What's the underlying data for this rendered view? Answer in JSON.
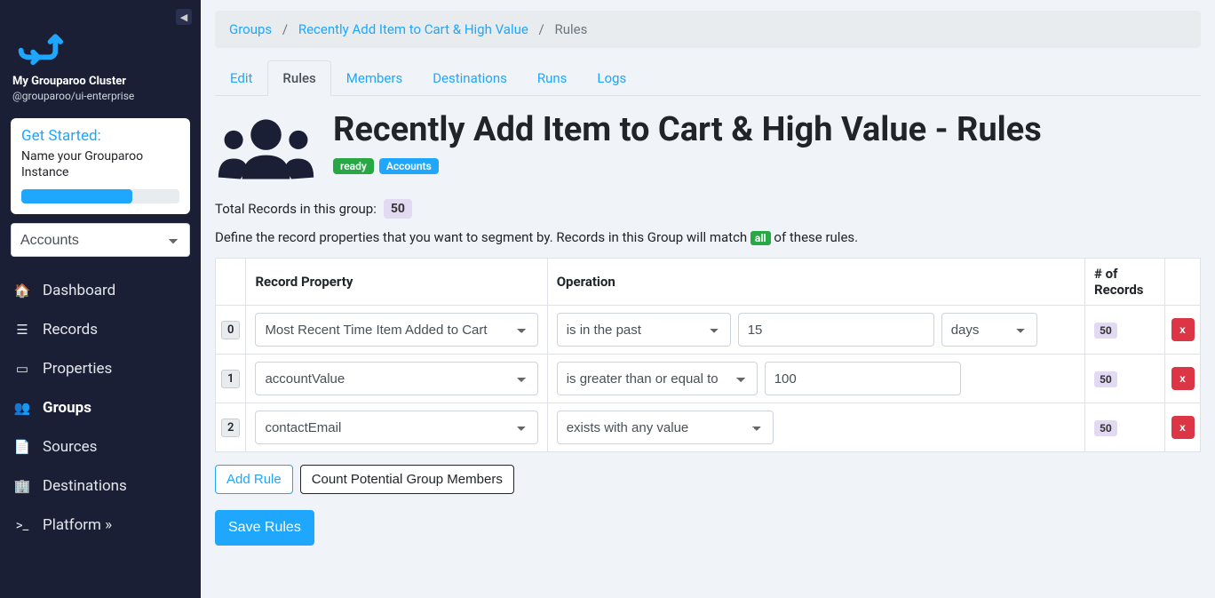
{
  "sidebar": {
    "cluster_title": "My Grouparoo Cluster",
    "cluster_sub": "@grouparoo/ui-enterprise",
    "getstarted_title": "Get Started:",
    "getstarted_text": "Name your Grouparoo Instance",
    "account_select": "Accounts",
    "nav": [
      {
        "label": "Dashboard",
        "icon": "home"
      },
      {
        "label": "Records",
        "icon": "list"
      },
      {
        "label": "Properties",
        "icon": "card"
      },
      {
        "label": "Groups",
        "icon": "users",
        "active": true
      },
      {
        "label": "Sources",
        "icon": "file"
      },
      {
        "label": "Destinations",
        "icon": "building"
      },
      {
        "label": "Platform »",
        "icon": "terminal"
      }
    ]
  },
  "breadcrumb": {
    "items": [
      "Groups",
      "Recently Add Item to Cart & High Value",
      "Rules"
    ]
  },
  "tabs": [
    "Edit",
    "Rules",
    "Members",
    "Destinations",
    "Runs",
    "Logs"
  ],
  "active_tab": "Rules",
  "page_title": "Recently Add Item to Cart & High Value - Rules",
  "badges": [
    {
      "label": "ready",
      "color": "green"
    },
    {
      "label": "Accounts",
      "color": "blue"
    }
  ],
  "total_label": "Total Records in this group:",
  "total_count": "50",
  "desc_pre": "Define the record properties that you want to segment by. Records in this Group will match ",
  "desc_badge": "all",
  "desc_post": " of these rules.",
  "table": {
    "headers": [
      "Record Property",
      "Operation",
      "# of Records"
    ],
    "rows": [
      {
        "idx": "0",
        "property": "Most Recent Time Item Added to Cart",
        "operation": "is in the past",
        "num": "15",
        "unit": "days",
        "records": "50"
      },
      {
        "idx": "1",
        "property": "accountValue",
        "operation": "is greater than or equal to",
        "value": "100",
        "records": "50"
      },
      {
        "idx": "2",
        "property": "contactEmail",
        "operation": "exists with any value",
        "records": "50"
      }
    ]
  },
  "delete_label": "x",
  "add_rule_label": "Add Rule",
  "count_label": "Count Potential Group Members",
  "save_label": "Save Rules"
}
